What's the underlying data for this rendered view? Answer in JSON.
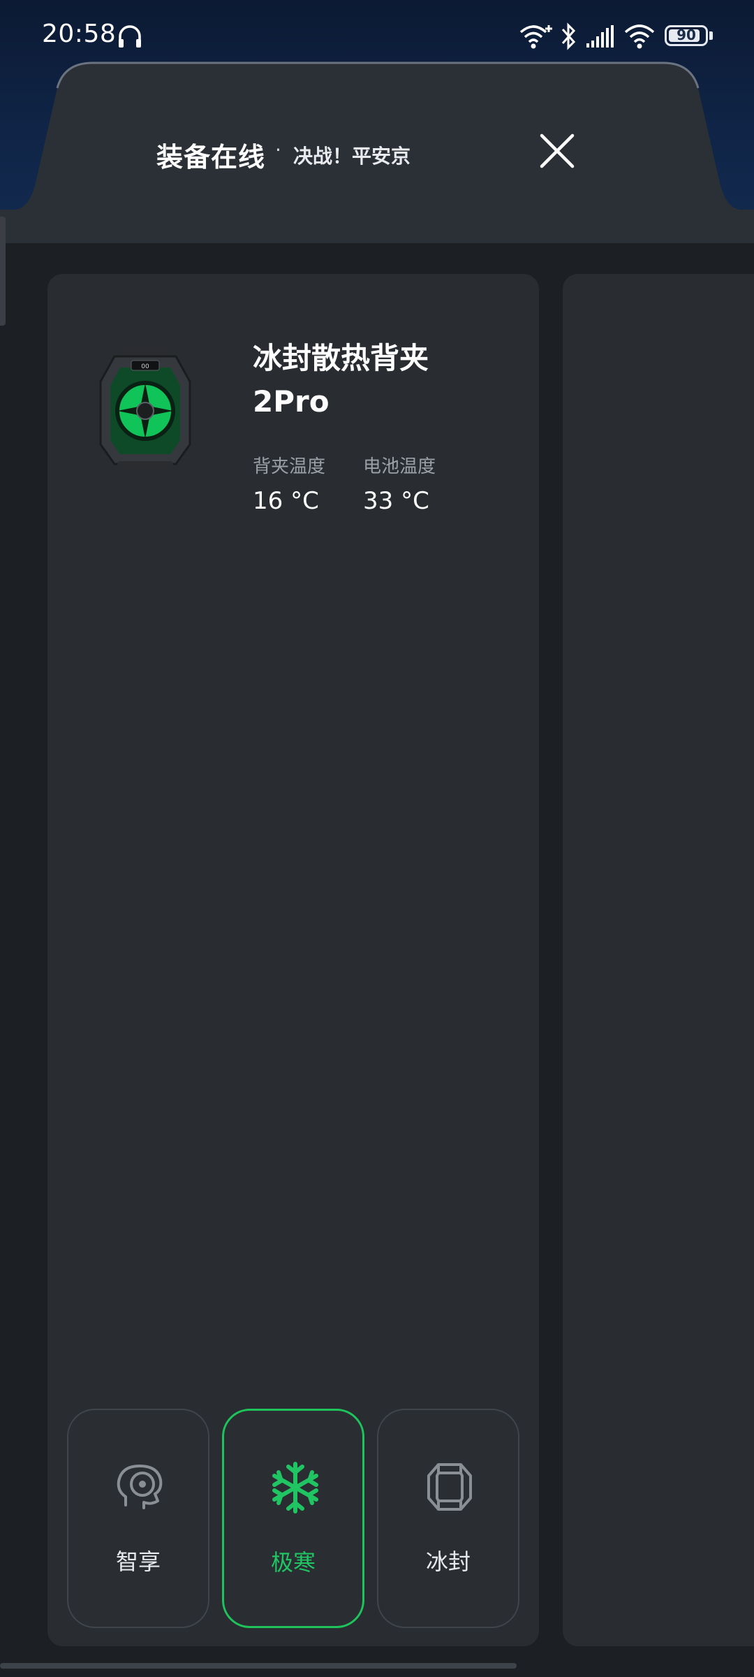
{
  "status_bar": {
    "time": "20:58",
    "battery_level": "90",
    "battery_fraction": 0.9,
    "icons": [
      "headphones-icon",
      "wifi-plus-icon",
      "bluetooth-icon",
      "signal-icon",
      "wifi-icon",
      "battery-icon"
    ]
  },
  "header": {
    "title": "装备在线",
    "separator": "·",
    "game": "决战！平安京",
    "close_icon": "close-icon"
  },
  "device": {
    "name": "冰封散热背夹 2Pro",
    "back_clip_temp_label": "背夹温度",
    "back_clip_temp_value": "16 °C",
    "battery_temp_label": "电池温度",
    "battery_temp_value": "33 °C"
  },
  "modes": [
    {
      "label": "智享",
      "icon": "smart-head-icon",
      "active": false
    },
    {
      "label": "极寒",
      "icon": "snowflake-icon",
      "active": true
    },
    {
      "label": "冰封",
      "icon": "ice-cube-icon",
      "active": false
    }
  ],
  "colors": {
    "accent": "#21c463",
    "card_bg": "#292d32",
    "page_bg": "#1c1f23",
    "top_band": "#0f2446"
  }
}
